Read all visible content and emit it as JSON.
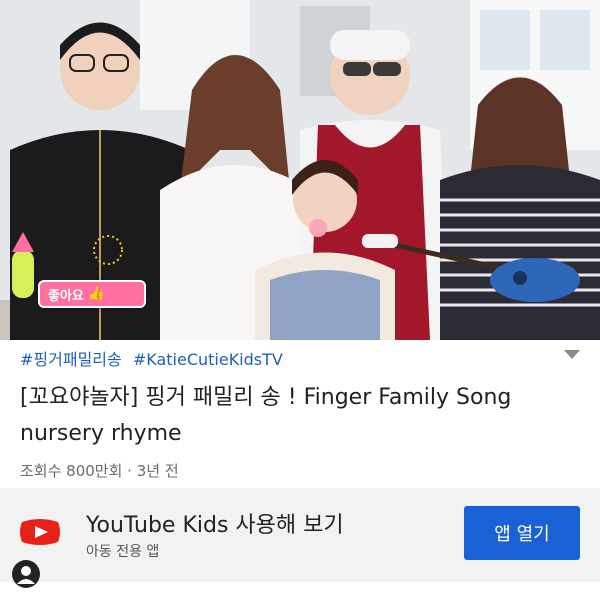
{
  "video": {
    "like_badge": {
      "text": "좋아요",
      "thumb_icon": "thumbs-up-icon"
    }
  },
  "hashtags": [
    "#핑거패밀리송",
    "#KatieCutieKidsTV"
  ],
  "title": "[꼬요야놀자] 핑거 패밀리 송 ! Finger Family Song nursery rhyme",
  "meta": "조회수 800만회 · 3년 전",
  "promo": {
    "app_name": "YouTube Kids 사용해 보기",
    "subtitle": "아동 전용 앱",
    "button_label": "앱 열기",
    "logo_icon": "youtube-kids-logo-icon",
    "brand_color": "#e62117",
    "button_color": "#1a61d6"
  },
  "icons": {
    "expand": "chevron-down-icon",
    "avatar": "profile-avatar-icon"
  }
}
